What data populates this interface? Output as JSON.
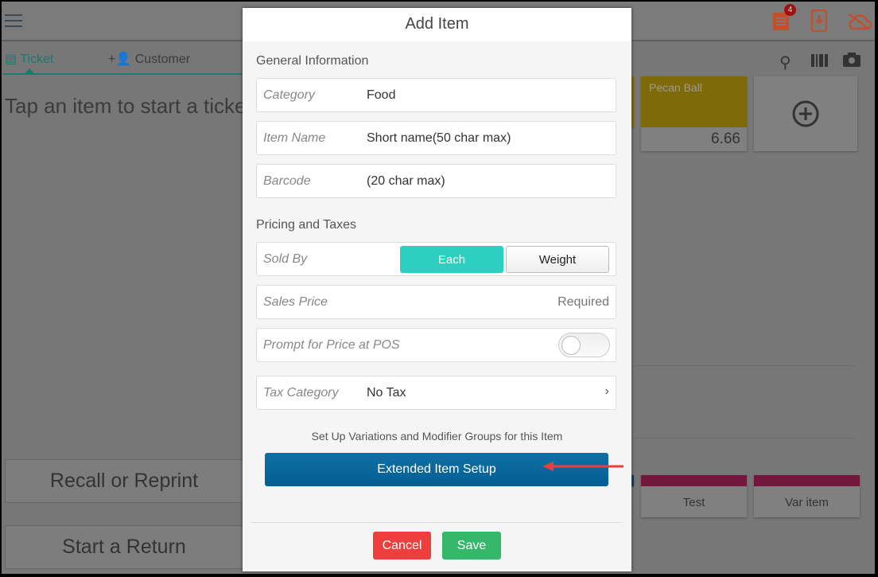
{
  "topbar": {
    "menu_icon": "hamburger-icon",
    "notification_badge": "4",
    "icons": [
      "ticket-icon",
      "download-device-icon",
      "cloud-off-icon"
    ],
    "accent_color": "#c0502e"
  },
  "tabs": [
    {
      "label": "Ticket",
      "icon": "ticket-icon",
      "active": true
    },
    {
      "label": "Customer",
      "icon": "add-person-icon"
    }
  ],
  "ticket": {
    "empty_message": "Tap an item to start a ticket"
  },
  "toolbar_icons": [
    "search-icon",
    "barcode-icon",
    "camera-icon"
  ],
  "tiles": [
    {
      "name": "Pecan Ball",
      "price": "6.66",
      "color": "#7f6a0a"
    },
    {
      "name": "Test",
      "color": "#73173d"
    },
    {
      "name": "Var item",
      "color": "#73173d"
    }
  ],
  "add_tile_icon": "plus-circle-icon",
  "left_buttons": {
    "recall": "Recall or Reprint",
    "return": "Start a Return"
  },
  "modal": {
    "title": "Add Item",
    "general_section": "General Information",
    "category": {
      "label": "Category",
      "value": "Food"
    },
    "item_name": {
      "label": "Item Name",
      "placeholder": "Short name(50 char max)"
    },
    "barcode": {
      "label": "Barcode",
      "placeholder": "(20 char max)"
    },
    "pricing_section": "Pricing and Taxes",
    "sold_by": {
      "label": "Sold By",
      "options": [
        "Each",
        "Weight"
      ],
      "selected": "Each",
      "accent": "#2ccfc0"
    },
    "sales_price": {
      "label": "Sales Price",
      "placeholder": "Required"
    },
    "prompt_price": {
      "label": "Prompt for Price at POS",
      "enabled": false
    },
    "tax_category": {
      "label": "Tax Category",
      "value": "No Tax"
    },
    "extended_hint": "Set Up Variations and Modifier Groups for this Item",
    "extended_button": "Extended Item Setup",
    "cancel": "Cancel",
    "save": "Save"
  }
}
